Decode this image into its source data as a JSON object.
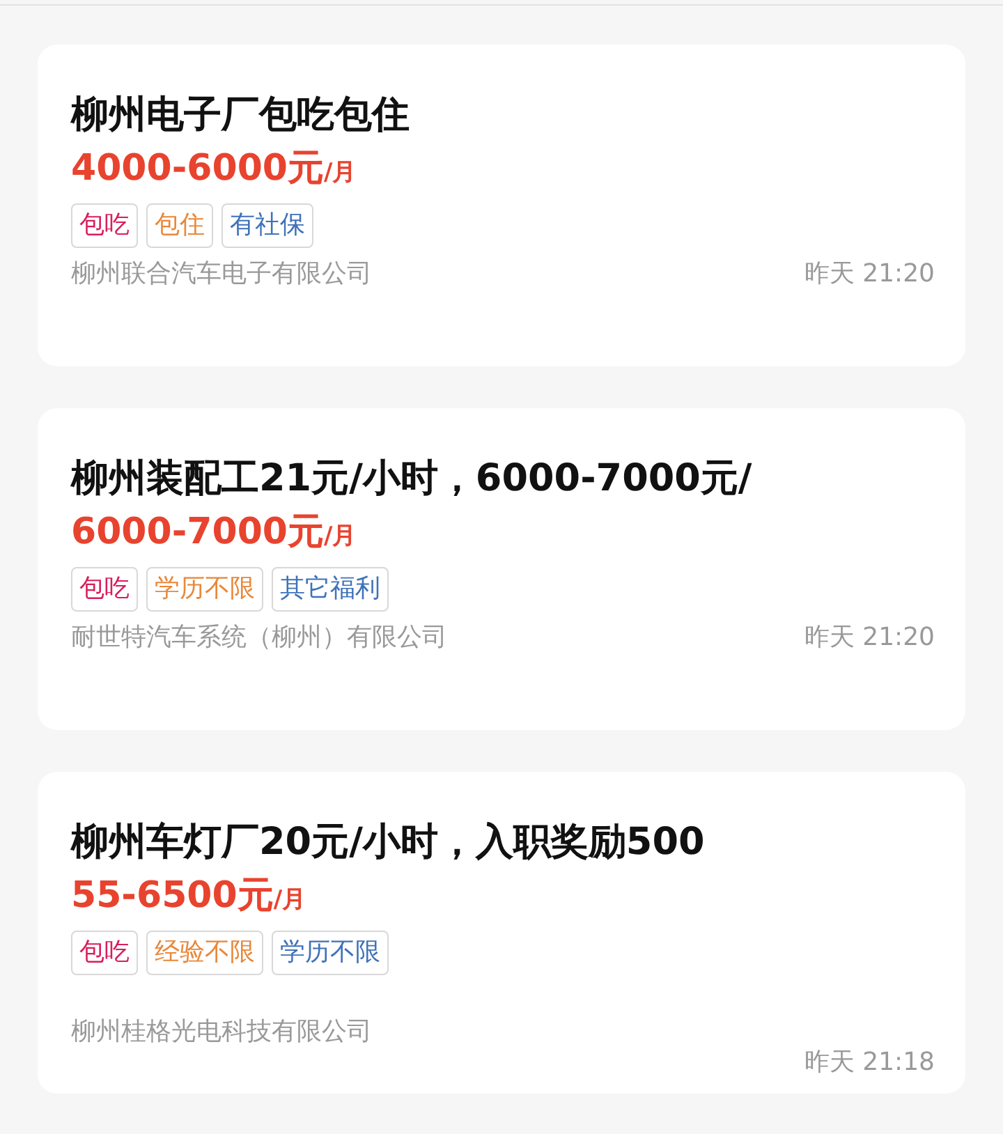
{
  "jobs": [
    {
      "title": "柳州电子厂包吃包住",
      "salary": "4000-6000元",
      "salary_unit": "/月",
      "tags": [
        {
          "label": "包吃",
          "color": "#d81e5b"
        },
        {
          "label": "包住",
          "color": "#e8883a"
        },
        {
          "label": "有社保",
          "color": "#3f72b8"
        }
      ],
      "company": "柳州联合汽车电子有限公司",
      "time": "昨天 21:20"
    },
    {
      "title": "柳州装配工21元/小时，6000-7000元/",
      "salary": "6000-7000元",
      "salary_unit": "/月",
      "tags": [
        {
          "label": "包吃",
          "color": "#d81e5b"
        },
        {
          "label": "学历不限",
          "color": "#e8883a"
        },
        {
          "label": "其它福利",
          "color": "#3f72b8"
        }
      ],
      "company": "耐世特汽车系统（柳州）有限公司",
      "time": "昨天 21:20"
    },
    {
      "title": "柳州车灯厂20元/小时，入职奖励500",
      "salary": "55-6500元",
      "salary_unit": "/月",
      "tags": [
        {
          "label": "包吃",
          "color": "#d81e5b"
        },
        {
          "label": "经验不限",
          "color": "#e8883a"
        },
        {
          "label": "学历不限",
          "color": "#3f72b8"
        }
      ],
      "company": "柳州桂格光电科技有限公司",
      "time": "昨天 21:18"
    }
  ]
}
